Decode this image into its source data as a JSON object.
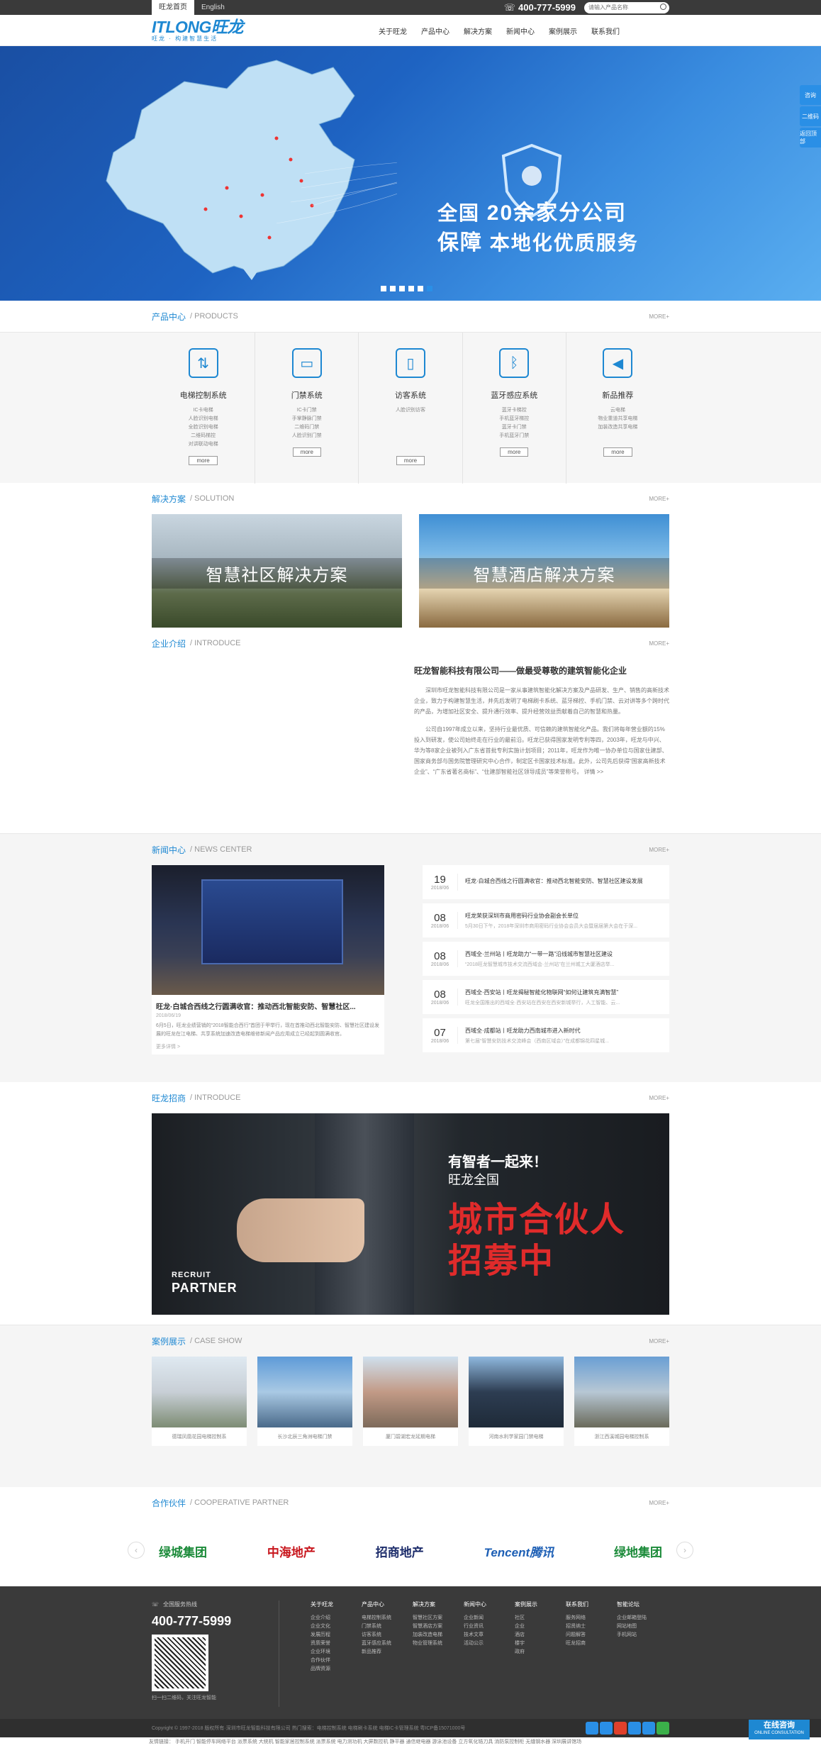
{
  "topbar": {
    "lang_cn": "旺龙首页",
    "lang_en": "English",
    "phone": "400-777-5999",
    "search_placeholder": "请输入产品名称"
  },
  "header": {
    "logo_text": "ITLONG旺龙",
    "logo_sub": "旺龙 · 构建智慧生活",
    "nav": [
      "关于旺龙",
      "产品中心",
      "解决方案",
      "新闻中心",
      "案例展示",
      "联系我们"
    ]
  },
  "banner": {
    "line1a": "全国",
    "line1b": "20余家分公司",
    "line2a": "保障",
    "line2b": "本地化优质服务"
  },
  "sidefloat": [
    "咨询",
    "二维码",
    "返回顶部"
  ],
  "more_label": "MORE+",
  "products": {
    "title_cn": "产品中心",
    "title_en": "/ PRODUCTS",
    "items": [
      {
        "name": "电梯控制系统",
        "subs": [
          "IC卡电梯",
          "人脸识别电梯",
          "全脸识别电梯",
          "二维码梯控",
          "对讲联动电梯"
        ],
        "btn": "more"
      },
      {
        "name": "门禁系统",
        "subs": [
          "IC卡门禁",
          "手掌静脉门禁",
          "二维码门禁",
          "人脸识别门禁"
        ],
        "btn": "more"
      },
      {
        "name": "访客系统",
        "subs": [
          "人脸识别访客"
        ],
        "btn": "more"
      },
      {
        "name": "蓝牙感应系统",
        "subs": [
          "蓝牙卡梯控",
          "手机蓝牙梯控",
          "蓝牙卡门禁",
          "手机蓝牙门禁"
        ],
        "btn": "more"
      },
      {
        "name": "新品推荐",
        "subs": [
          "云电梯",
          "物业重道共享电梯",
          "加装改造共享电梯"
        ],
        "btn": "more"
      }
    ]
  },
  "solutions": {
    "title_cn": "解决方案",
    "title_en": "/ SOLUTION",
    "items": [
      "智慧社区解决方案",
      "智慧酒店解决方案"
    ]
  },
  "introduce": {
    "title_cn": "企业介绍",
    "title_en": "/ INTRODUCE",
    "heading": "旺龙智能科技有限公司——做最受尊敬的建筑智能化企业",
    "p1": "深圳市旺龙智能科技有限公司是一家从事建筑智能化解决方案及产品研发、生产、销售的高新技术企业，致力于构建智慧生活，并先后发明了电梯刷卡系统、蓝牙梯控、手机门禁、云对讲等多个跨时代的产品，为增加社区安全、提升通行效率、提升经营效益贡献着自己的智慧和热量。",
    "p2": "公司自1997年成立以来，坚持行业最优质、可信赖的建筑智能化产品。我们将每年营业额的15%投入到研发，使公司始终走在行业的最前沿。旺龙已获得国家发明专利等四，2003年，旺龙与中兴、华为等8家企业被列入广东省首批专利实施计划项目；2011年，旺龙作为唯一协办单位与国家住建部、国家商务部与国务院管理研究中心合作，制定区卡国家技术标准。此外，公司先后获得“国家高新技术企业”、“广东省著名商标”、“住建部智能社区领导成员”等荣誉称号。",
    "more_link": "详情 >>"
  },
  "news": {
    "title_cn": "新闻中心",
    "title_en": "/ NEWS CENTER",
    "feature_title": "旺龙·白城合西线之行圆满收官：推动西北智能安防、智慧社区...",
    "feature_date": "2018/06/19",
    "feature_desc": "6月5日，旺龙业绩营销的“2018智能合西行”首团于甲举行，现在首推动西北智能安防、智慧社区建设发展的旺龙在江电梯、共享系统加速改造电梯维修新闻产品应用成立已经起到圆满收官。",
    "feature_more": "更多详情 >",
    "items": [
      {
        "day": "19",
        "ym": "2018/06",
        "title": "旺龙·白城合西线之行圆满收官：推动西北智能安防、智慧社区建设发展",
        "sub": ""
      },
      {
        "day": "08",
        "ym": "2018/06",
        "title": "旺龙荣获深圳市商用密码行业协会副会长单位",
        "sub": "5月30日下午，2018年深圳市商用密码行业协会会员大会暨届届第大会在于深..."
      },
      {
        "day": "08",
        "ym": "2018/06",
        "title": "西域全·兰州站丨旺龙助力“一带一路”沿线城市智慧社区建设",
        "sub": "“2018旺龙智慧城市技术交流西域会·兰州站”在兰州城工大厦酒店举..."
      },
      {
        "day": "08",
        "ym": "2018/06",
        "title": "西域全·西安站丨旺龙揭秘智能化物联网“如何让建筑充满智慧”",
        "sub": "旺龙全国推出的西域全·西安站在西安在西安新城举行，人工智能、云..."
      },
      {
        "day": "07",
        "ym": "2018/06",
        "title": "西域全·成都站丨旺龙助力西南城市进入新时代",
        "sub": "第七届“智慧安防技术交流峰会（西南区域会）”在成都锦花四星城..."
      }
    ]
  },
  "recruit": {
    "title_cn": "旺龙招商",
    "title_en": "/ INTRODUCE",
    "line1": "有智者一起来！",
    "line2": "旺龙全国",
    "line3": "城市合伙人",
    "line4": "招募中",
    "en1": "RECRUIT",
    "en2": "PARTNER"
  },
  "cases": {
    "title_cn": "案例展示",
    "title_en": "/ CASE SHOW",
    "items": [
      "德瑞凤凰花园电梯控制系",
      "长沙北辰三角洲电梯门禁",
      "厦门碧湖宏龙延期电梯",
      "河南水利学家园门禁电梯",
      "浙江西溪城园电梯控制系"
    ]
  },
  "partners": {
    "title_cn": "合作伙伴",
    "title_en": "/ COOPERATIVE PARTNER",
    "items": [
      "绿城集团",
      "中海地产",
      "招商地产",
      "Tencent腾讯",
      "绿地集团"
    ],
    "colors": [
      "#1c8b3a",
      "#c8161d",
      "#1d2d6b",
      "#1d5fb5",
      "#1c8b3a"
    ]
  },
  "footer": {
    "hotline_label": "全国服务热线",
    "hotline": "400-777-5999",
    "scan": "扫一扫二维码，关注旺龙智能",
    "cols": [
      {
        "h": "关于旺龙",
        "items": [
          "企业介绍",
          "企业文化",
          "发展历程",
          "资质荣誉",
          "企业环境",
          "合作伙伴",
          "品牌资源"
        ]
      },
      {
        "h": "产品中心",
        "items": [
          "电梯控制系统",
          "门禁系统",
          "访客系统",
          "蓝牙感应系统",
          "新品推荐"
        ]
      },
      {
        "h": "解决方案",
        "items": [
          "智慧社区方案",
          "智慧酒店方案",
          "加装改造电梯",
          "物业管理系统"
        ]
      },
      {
        "h": "新闻中心",
        "items": [
          "企业新闻",
          "行业资讯",
          "技术文章",
          "活动公示"
        ]
      },
      {
        "h": "案例展示",
        "items": [
          "社区",
          "企业",
          "酒店",
          "楼宇",
          "政府"
        ]
      },
      {
        "h": "联系我们",
        "items": [
          "服务网络",
          "招贤纳士",
          "问题解答",
          "旺龙招商"
        ]
      },
      {
        "h": "智能论坛",
        "items": [
          "企业邮箱登陆",
          "网站地图",
          "手机网站"
        ]
      }
    ],
    "copyright": "Copyright © 1997-2018 版权所有·深圳市旺龙智能科技有限公司 热门搜索：电梯控制系统 电梯刷卡系统 电梯IC卡管理系统 粤ICP备15071000号",
    "links": "友情链接：  手机开门 智能停车网络平台 派票系统 大统机 智能家居控制系统 派票系统 电力测功机 大屏数控机 静平器 通信继电器 游泳池设备 立方氧化锆刀具 消防泵控制柜 无缝钢水器 深圳展讲馆场",
    "consult": "在线咨询",
    "consult_en": "ONLINE CONSULTATION"
  }
}
